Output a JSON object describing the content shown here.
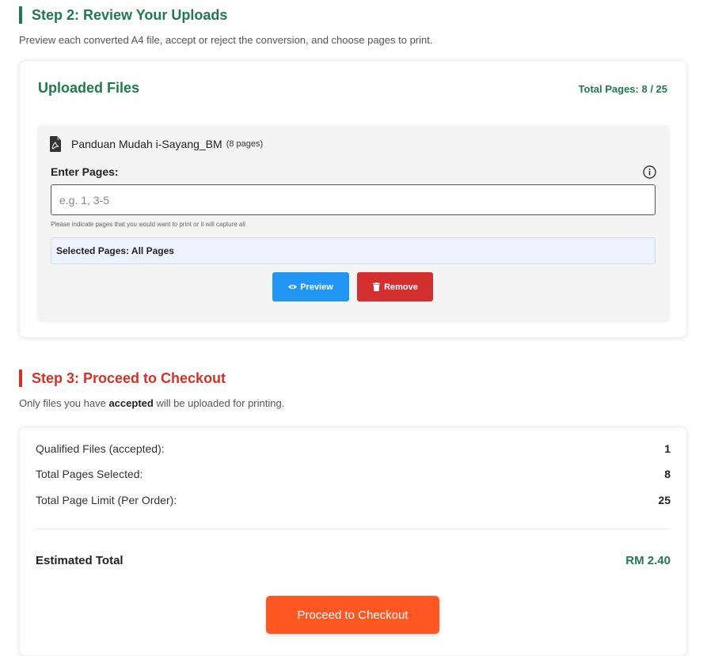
{
  "step2": {
    "title": "Step 2: Review Your Uploads",
    "description": "Preview each converted A4 file, accept or reject the conversion, and choose pages to print."
  },
  "uploads": {
    "title": "Uploaded Files",
    "total_pages": "Total Pages: 8 / 25",
    "file": {
      "icon": "pdf-file-icon",
      "name": "Panduan Mudah i-Sayang_BM",
      "pages": "(8 pages)",
      "enter_label": "Enter Pages:",
      "input_value": "",
      "input_placeholder": "e.g. 1, 3-5",
      "hint": "Please indicate pages that you would want to print or it will capture all",
      "selected_pages": "Selected Pages: All Pages",
      "preview_label": "Preview",
      "remove_label": "Remove"
    }
  },
  "step3": {
    "title": "Step 3: Proceed to Checkout",
    "desc_before": "Only files you have ",
    "desc_bold": "accepted",
    "desc_after": " will be uploaded for printing."
  },
  "checkout": {
    "rows": [
      {
        "label": "Qualified Files (accepted):",
        "value": "1"
      },
      {
        "label": "Total Pages Selected:",
        "value": "8"
      },
      {
        "label": "Total Page Limit (Per Order):",
        "value": "25"
      }
    ],
    "estimated_label": "Estimated Total",
    "estimated_value": "RM 2.40",
    "button_label": "Proceed to Checkout"
  },
  "colors": {
    "green": "#1f7a4d",
    "red": "#d93025",
    "blue": "#2196f3",
    "remove": "#d32f2f",
    "orange": "#ff5722"
  }
}
